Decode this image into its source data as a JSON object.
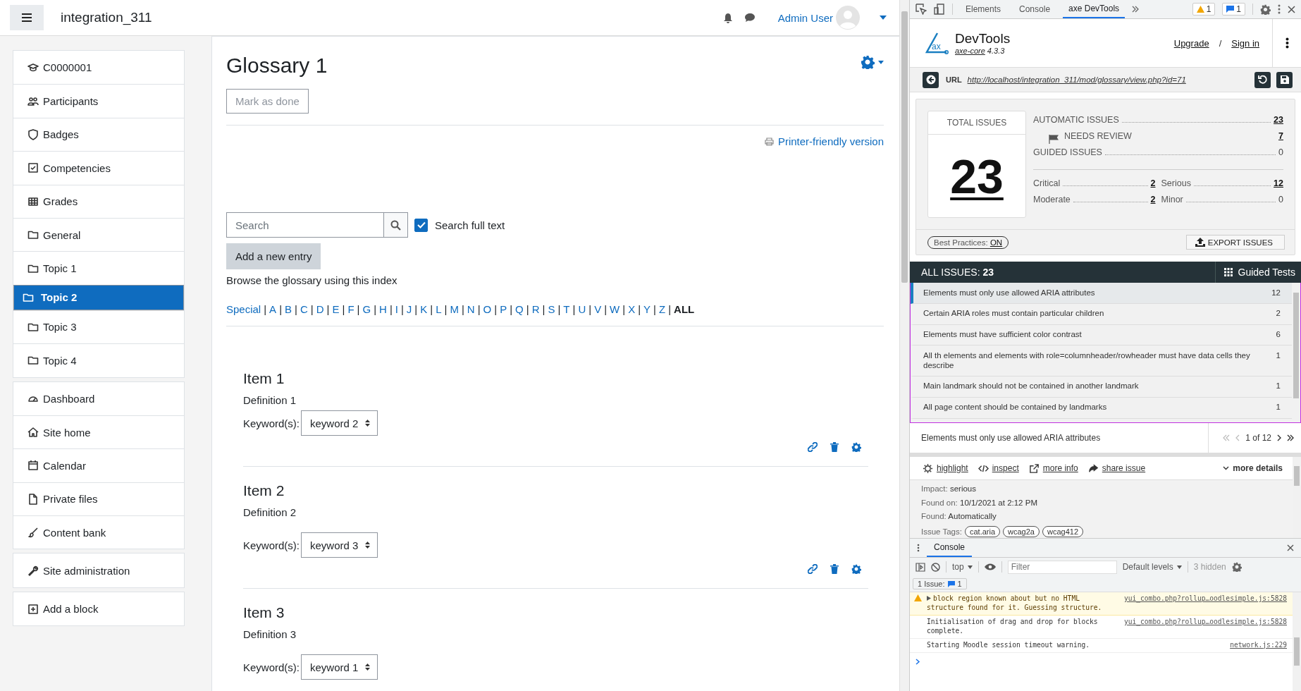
{
  "topbar": {
    "site_name": "integration_311",
    "user_name": "Admin User"
  },
  "sidebar": {
    "groups": [
      [
        {
          "label": "C0000001",
          "selected": false
        },
        {
          "label": "Participants",
          "selected": false
        },
        {
          "label": "Badges",
          "selected": false
        },
        {
          "label": "Competencies",
          "selected": false
        },
        {
          "label": "Grades",
          "selected": false
        },
        {
          "label": "General",
          "selected": false
        },
        {
          "label": "Topic 1",
          "selected": false
        },
        {
          "label": "Topic 2",
          "selected": true
        },
        {
          "label": "Topic 3",
          "selected": false
        },
        {
          "label": "Topic 4",
          "selected": false
        }
      ],
      [
        {
          "label": "Dashboard",
          "selected": false
        },
        {
          "label": "Site home",
          "selected": false
        },
        {
          "label": "Calendar",
          "selected": false
        },
        {
          "label": "Private files",
          "selected": false
        },
        {
          "label": "Content bank",
          "selected": false
        }
      ],
      [
        {
          "label": "Site administration",
          "selected": false
        }
      ],
      [
        {
          "label": "Add a block",
          "selected": false
        }
      ]
    ]
  },
  "main": {
    "title": "Glossary 1",
    "mark_done": "Mark as done",
    "printer_link": "Printer-friendly version",
    "search": {
      "placeholder": "Search"
    },
    "search_full_text": {
      "label": "Search full text",
      "checked": true
    },
    "add_entry": "Add a new entry",
    "browse_text": "Browse the glossary using this index",
    "index": {
      "separator": "|",
      "letters": [
        {
          "label": "Special",
          "selected": false
        },
        {
          "label": "A",
          "selected": false
        },
        {
          "label": "B",
          "selected": false
        },
        {
          "label": "C",
          "selected": false
        },
        {
          "label": "D",
          "selected": false
        },
        {
          "label": "E",
          "selected": false
        },
        {
          "label": "F",
          "selected": false
        },
        {
          "label": "G",
          "selected": false
        },
        {
          "label": "H",
          "selected": false
        },
        {
          "label": "I",
          "selected": false
        },
        {
          "label": "J",
          "selected": false
        },
        {
          "label": "K",
          "selected": false
        },
        {
          "label": "L",
          "selected": false
        },
        {
          "label": "M",
          "selected": false
        },
        {
          "label": "N",
          "selected": false
        },
        {
          "label": "O",
          "selected": false
        },
        {
          "label": "P",
          "selected": false
        },
        {
          "label": "Q",
          "selected": false
        },
        {
          "label": "R",
          "selected": false
        },
        {
          "label": "S",
          "selected": false
        },
        {
          "label": "T",
          "selected": false
        },
        {
          "label": "U",
          "selected": false
        },
        {
          "label": "V",
          "selected": false
        },
        {
          "label": "W",
          "selected": false
        },
        {
          "label": "X",
          "selected": false
        },
        {
          "label": "Y",
          "selected": false
        },
        {
          "label": "Z",
          "selected": false
        },
        {
          "label": "ALL",
          "selected": true
        }
      ]
    },
    "entries": [
      {
        "title": "Item 1",
        "definition": "Definition 1",
        "keyword_label": "Keyword(s):",
        "keyword": "keyword 2",
        "show_actions": true
      },
      {
        "title": "Item 2",
        "definition": "Definition 2",
        "keyword_label": "Keyword(s):",
        "keyword": "keyword 3",
        "show_actions": true
      },
      {
        "title": "Item 3",
        "definition": "Definition 3",
        "keyword_label": "Keyword(s):",
        "keyword": "keyword 1",
        "show_actions": false
      }
    ]
  },
  "devtools": {
    "tabs": [
      {
        "label": "Elements",
        "selected": false
      },
      {
        "label": "Console",
        "selected": false
      },
      {
        "label": "axe DevTools",
        "selected": true
      }
    ],
    "warning_count": "1",
    "message_count": "1",
    "axe": {
      "logo_text": "ax",
      "product": "DevTools",
      "core_link": "axe-core",
      "core_version": "4.3.3",
      "upgrade": "Upgrade",
      "separator": "/",
      "sign_in": "Sign in",
      "url_label": "URL",
      "url": "http://localhost/integration_311/mod/glossary/view.php?id=71",
      "total_label": "TOTAL ISSUES",
      "total": "23",
      "summary": [
        {
          "label": "AUTOMATIC ISSUES",
          "value": "23",
          "kind": "main"
        },
        {
          "label": "NEEDS REVIEW",
          "value": "7",
          "kind": "sub"
        },
        {
          "label": "GUIDED ISSUES",
          "value": "0",
          "kind": "main"
        }
      ],
      "impacts": [
        {
          "label": "Critical",
          "value": "2"
        },
        {
          "label": "Serious",
          "value": "12"
        },
        {
          "label": "Moderate",
          "value": "2"
        },
        {
          "label": "Minor",
          "value": "0"
        }
      ],
      "best_practices_label": "Best Practices:",
      "best_practices_value": "ON",
      "export": "EXPORT ISSUES",
      "all_issues_label": "ALL ISSUES:",
      "all_issues_count": "23",
      "guided_tests": "Guided Tests",
      "issues": [
        {
          "title": "Elements must only use allowed ARIA attributes",
          "count": "12",
          "selected": true
        },
        {
          "title": "Certain ARIA roles must contain particular children",
          "count": "2",
          "selected": false
        },
        {
          "title": "Elements must have sufficient color contrast",
          "count": "6",
          "selected": false
        },
        {
          "title": "All th elements and elements with role=columnheader/rowheader must have data cells they describe",
          "count": "1",
          "selected": false
        },
        {
          "title": "Main landmark should not be contained in another landmark",
          "count": "1",
          "selected": false
        },
        {
          "title": "All page content should be contained by landmarks",
          "count": "1",
          "selected": false
        }
      ],
      "current_issue": "Elements must only use allowed ARIA attributes",
      "pager": "1 of 12",
      "actions": [
        "highlight",
        "inspect",
        "more info",
        "share issue"
      ],
      "more_details": "more details",
      "details": [
        {
          "label": "Impact:",
          "value": "serious"
        },
        {
          "label": "Found on:",
          "value": "10/1/2021 at 2:12 PM"
        },
        {
          "label": "Found:",
          "value": "Automatically"
        }
      ],
      "tags_label": "Issue Tags:",
      "tags": [
        "cat.aria",
        "wcag2a",
        "wcag412"
      ]
    },
    "console": {
      "tab": "Console",
      "context": "top",
      "filter_placeholder": "Filter",
      "levels": "Default levels",
      "hidden": "3 hidden",
      "issues_label": "1 Issue:",
      "issues_count": "1",
      "messages": [
        {
          "kind": "warning",
          "text": "block region known about but no HTML structure found for it. Guessing structure.",
          "source": "yui_combo.php?rollup…oodlesimple.js:5828"
        },
        {
          "kind": "info",
          "text": "Initialisation of drag and drop for blocks complete.",
          "source": "yui_combo.php?rollup…oodlesimple.js:5828"
        },
        {
          "kind": "info",
          "text": "Starting Moodle session timeout warning.",
          "source": "network.js:229"
        }
      ]
    }
  }
}
